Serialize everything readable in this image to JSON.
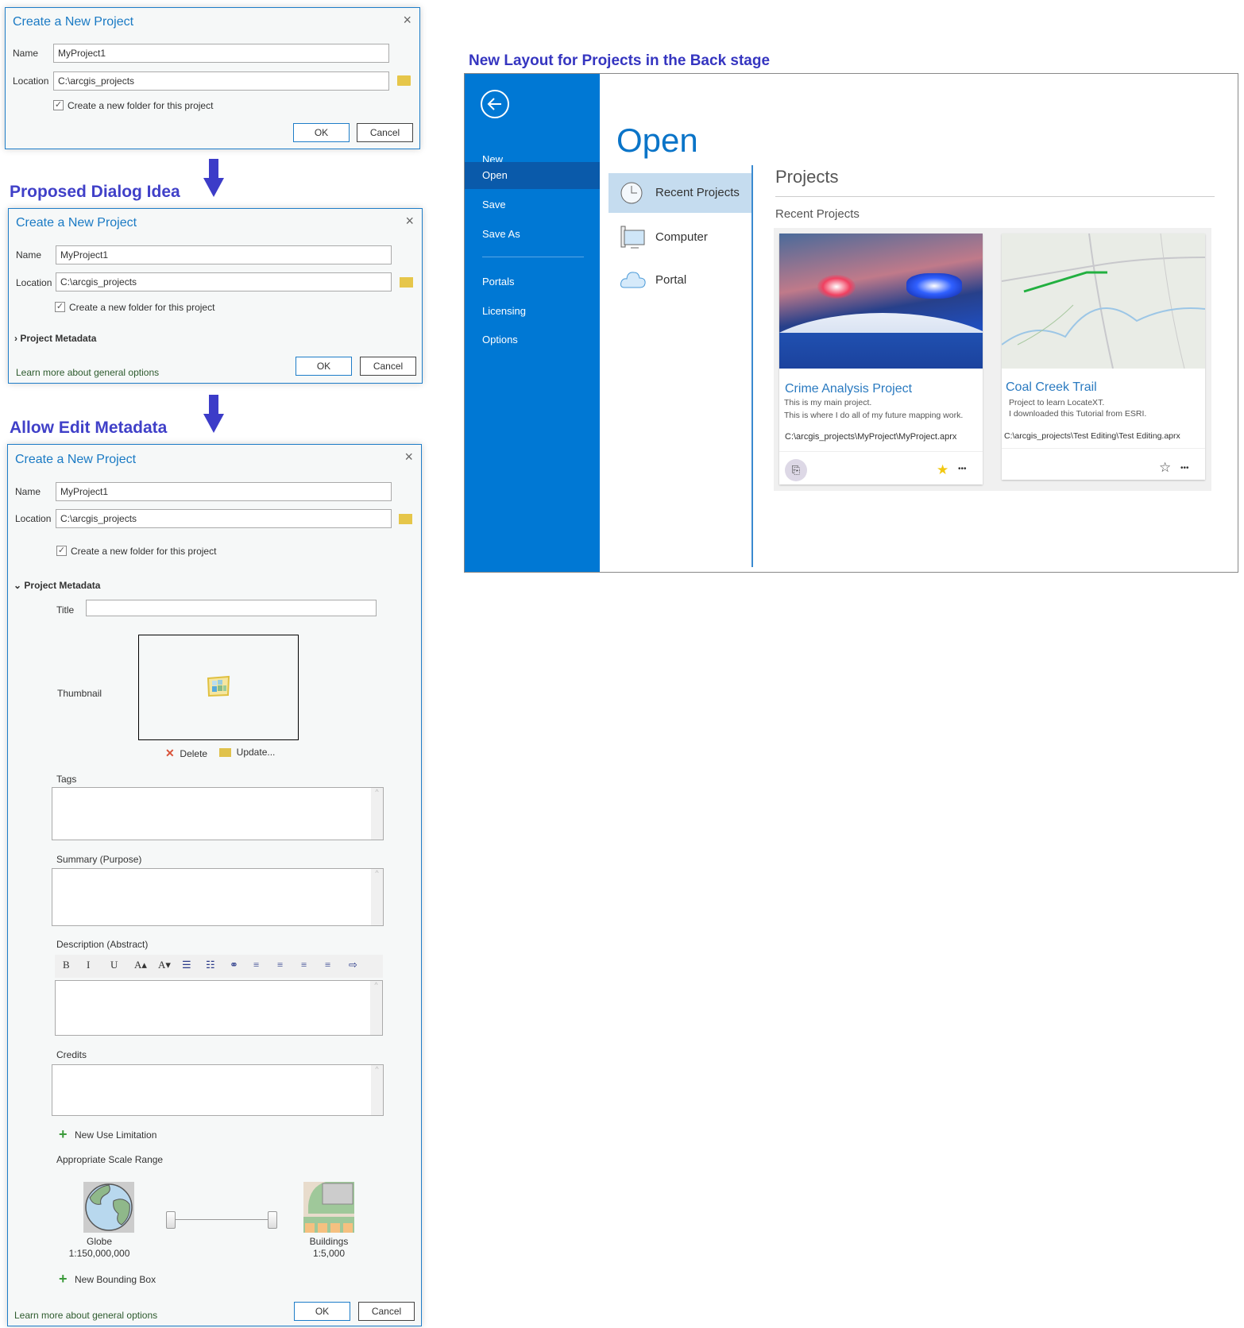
{
  "dialog_common": {
    "title": "Create a New Project",
    "name_label": "Name",
    "name_value": "MyProject1",
    "location_label": "Location",
    "location_value": "C:\\arcgis_projects",
    "new_folder_label": "Create a new folder for this project",
    "ok": "OK",
    "cancel": "Cancel",
    "close": "×",
    "learn_more": "Learn more about general options",
    "metadata_label": "Project Metadata"
  },
  "headings": {
    "proposed": "Proposed Dialog Idea",
    "allow_edit": "Allow Edit Metadata",
    "backstage": "New Layout for Projects in the Back stage"
  },
  "metadata": {
    "title_label": "Title",
    "title_value": "",
    "thumbnail_label": "Thumbnail",
    "delete": "Delete",
    "update": "Update...",
    "tags_label": "Tags",
    "summary_label": "Summary (Purpose)",
    "description_label": "Description (Abstract)",
    "credits_label": "Credits",
    "new_use_limitation": "New Use Limitation",
    "scale_range_label": "Appropriate Scale Range",
    "min_scale_name": "Globe",
    "min_scale": "1:150,000,000",
    "max_scale_name": "Buildings",
    "max_scale": "1:5,000",
    "new_bounding_box": "New Bounding Box",
    "toolbar": [
      "B",
      "I",
      "U",
      "A▴",
      "A▾",
      "☰",
      "☷",
      "⚭",
      "≡",
      "≡",
      "≡",
      "≡",
      "⇨"
    ]
  },
  "backstage": {
    "menu": [
      {
        "label": "New"
      },
      {
        "label": "Open",
        "active": true
      },
      {
        "label": "Save"
      },
      {
        "label": "Save As"
      },
      {
        "label": "Portals"
      },
      {
        "label": "Licensing"
      },
      {
        "label": "Options"
      }
    ],
    "page_title": "Open",
    "locations": [
      {
        "label": "Recent Projects",
        "icon": "clock-icon",
        "active": true
      },
      {
        "label": "Computer",
        "icon": "computer-icon"
      },
      {
        "label": "Portal",
        "icon": "cloud-icon"
      }
    ],
    "section_title": "Projects",
    "subsection": "Recent Projects",
    "projects": [
      {
        "title": "Crime Analysis Project",
        "desc1": "This is my main project.",
        "desc2": "This is where I do all of my future mapping work.",
        "path": "C:\\arcgis_projects\\MyProject\\MyProject.aprx",
        "favorite": true
      },
      {
        "title": "Coal Creek Trail",
        "desc1": "Project to learn LocateXT.",
        "desc2": "I downloaded this Tutorial from ESRI.",
        "path": "C:\\arcgis_projects\\Test Editing\\Test Editing.aprx",
        "favorite": false
      }
    ],
    "more": "•••",
    "star_filled": "★",
    "star_empty": "☆"
  },
  "colors": {
    "accent": "#0078d4",
    "heading": "#4040c8"
  }
}
